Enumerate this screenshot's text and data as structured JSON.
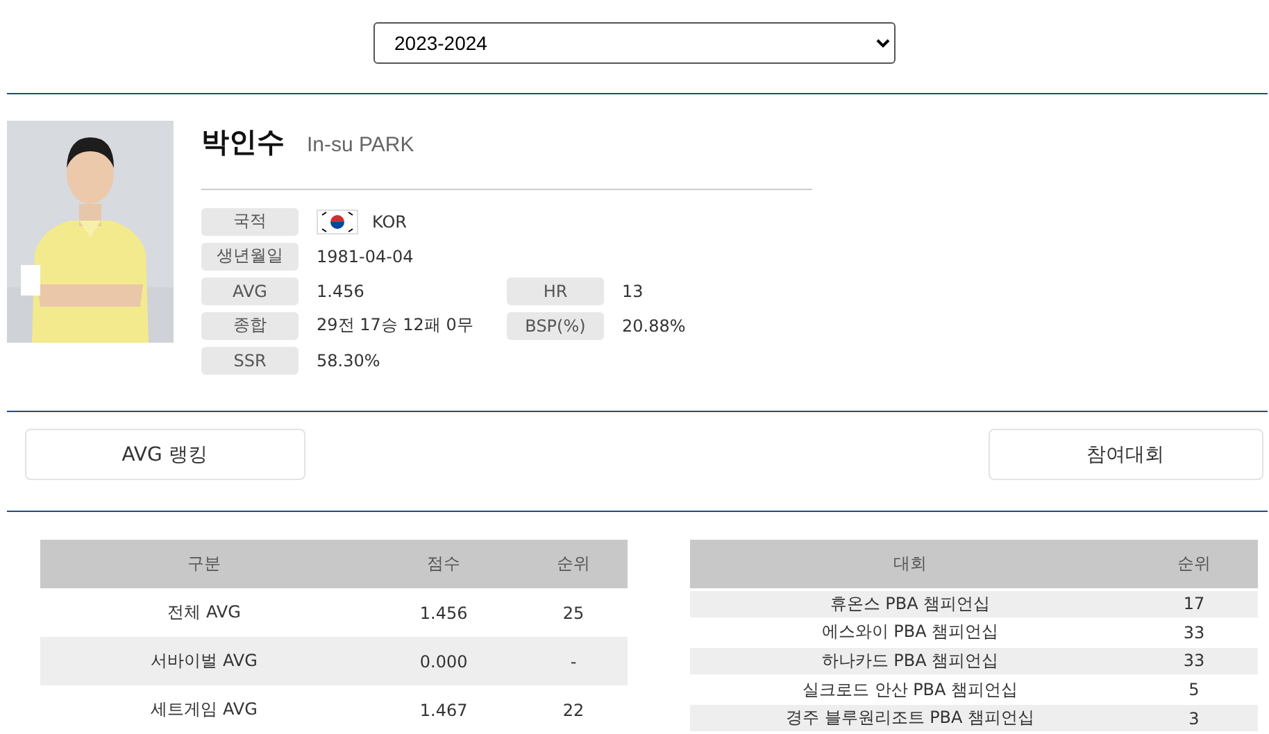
{
  "season_select": {
    "value": "2023-2024"
  },
  "player": {
    "name_ko": "박인수",
    "name_en": "In-su PARK",
    "fields": [
      {
        "label": "국적",
        "value": "KOR",
        "kind": "flag"
      },
      {
        "label": "생년월일",
        "value": "1981-04-04",
        "kind": "text"
      },
      {
        "label": "AVG",
        "value": "1.456",
        "kind": "text",
        "label2": "HR",
        "value2": "13"
      },
      {
        "label": "종합",
        "value": "29전 17승 12패 0무",
        "kind": "text",
        "label2": "BSP(%)",
        "value2": "20.88%"
      },
      {
        "label": "SSR",
        "value": "58.30%",
        "kind": "text"
      }
    ]
  },
  "buttons": [
    "AVG 랭킹",
    "참여대회"
  ],
  "avg_table": {
    "columns": [
      "구분",
      "점수",
      "순위"
    ],
    "rows": [
      [
        "전체 AVG",
        "1.456",
        "25"
      ],
      [
        "서바이벌 AVG",
        "0.000",
        "-"
      ],
      [
        "세트게임 AVG",
        "1.467",
        "22"
      ]
    ]
  },
  "tournament_table": {
    "columns": [
      "대회",
      "순위"
    ],
    "rows": [
      [
        "휴온스 PBA 챔피언십",
        "17"
      ],
      [
        "에스와이 PBA 챔피언십",
        "33"
      ],
      [
        "하나카드 PBA 챔피언십",
        "33"
      ],
      [
        "실크로드 안산 PBA 챔피언십",
        "5"
      ],
      [
        "경주 블루원리조트 PBA 챔피언십",
        "3"
      ]
    ]
  }
}
